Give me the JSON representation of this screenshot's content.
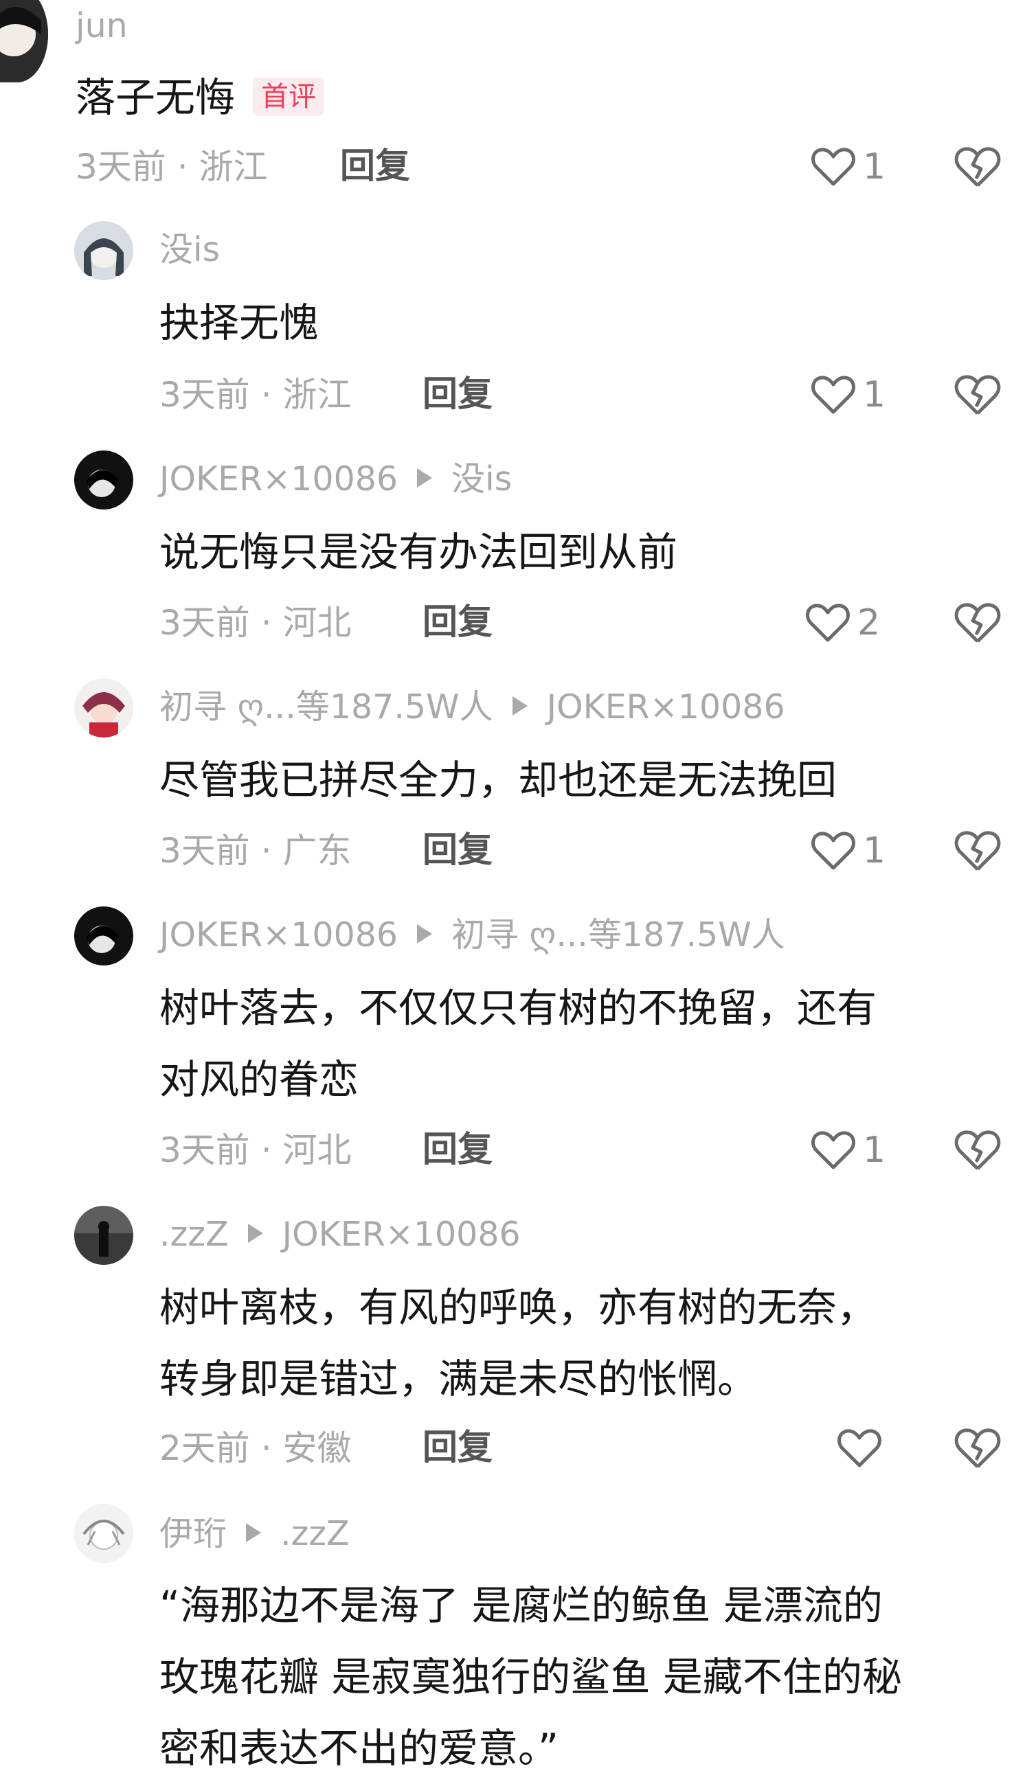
{
  "comments": [
    {
      "username": "jun",
      "reply_to": "",
      "badge": "首评",
      "lines": [
        "落子无悔"
      ],
      "time_location": "3天前 · 浙江",
      "reply_label": "回复",
      "likes": "1"
    },
    {
      "username": "没is",
      "reply_to": "",
      "badge": "",
      "lines": [
        "抉择无愧"
      ],
      "time_location": "3天前 · 浙江",
      "reply_label": "回复",
      "likes": "1"
    },
    {
      "username": "JOKER×10086",
      "reply_to": "没is",
      "badge": "",
      "lines": [
        "说无悔只是没有办法回到从前"
      ],
      "time_location": "3天前 · 河北",
      "reply_label": "回复",
      "likes": "2"
    },
    {
      "username": "初寻 ღ...等187.5W人",
      "reply_to": "JOKER×10086",
      "badge": "",
      "lines": [
        "尽管我已拼尽全力，却也还是无法挽回"
      ],
      "time_location": "3天前 · 广东",
      "reply_label": "回复",
      "likes": "1"
    },
    {
      "username": "JOKER×10086",
      "reply_to": "初寻 ღ...等187.5W人",
      "badge": "",
      "lines": [
        "树叶落去，不仅仅只有树的不挽留，还有",
        "对风的眷恋"
      ],
      "time_location": "3天前 · 河北",
      "reply_label": "回复",
      "likes": "1"
    },
    {
      "username": ".zzZ",
      "reply_to": "JOKER×10086",
      "badge": "",
      "lines": [
        "树叶离枝，有风的呼唤，亦有树的无奈，",
        "转身即是错过，满是未尽的怅惘。"
      ],
      "time_location": "2天前 · 安徽",
      "reply_label": "回复",
      "likes": ""
    },
    {
      "username": "伊珩",
      "reply_to": ".zzZ",
      "badge": "",
      "lines": [
        "“海那边不是海了 是腐烂的鲸鱼 是漂流的",
        "玫瑰花瓣 是寂寞独行的鲨鱼 是藏不住的秘",
        "密和表达不出的爱意。”"
      ],
      "time_location": "",
      "reply_label": "",
      "likes": ""
    }
  ],
  "colors": {
    "text": "#161616",
    "meta": "#a9a9ad",
    "badge": "#f03e5c"
  },
  "icons": {
    "like": "heart-outline-icon",
    "dislike": "broken-heart-icon"
  }
}
